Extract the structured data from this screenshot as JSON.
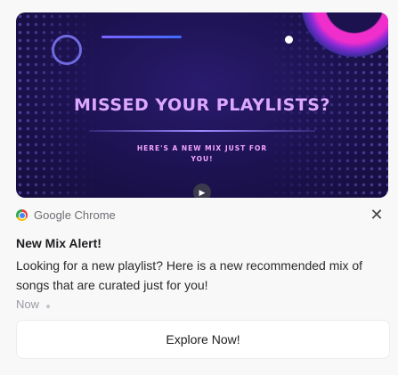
{
  "banner": {
    "title": "MISSED YOUR PLAYLISTS?",
    "subtitle": "HERE'S A NEW MIX JUST FOR YOU!",
    "play_icon": "play-icon"
  },
  "source": {
    "app_name": "Google Chrome",
    "icon": "chrome-icon",
    "close_icon": "close-icon",
    "close_glyph": "✕"
  },
  "notification": {
    "title": "New Mix Alert!",
    "body": "Looking for a new playlist? Here is a new recommended mix of songs that are curated just for you!",
    "time": "Now"
  },
  "action": {
    "label": "Explore Now!"
  },
  "colors": {
    "banner_bg": "#1c1250",
    "banner_title": "#dda7ff",
    "banner_subtitle": "#f3a6ff",
    "accent_pink": "#ef2ecb",
    "text_primary": "#1d1d1f",
    "text_secondary": "#6e6e73"
  }
}
